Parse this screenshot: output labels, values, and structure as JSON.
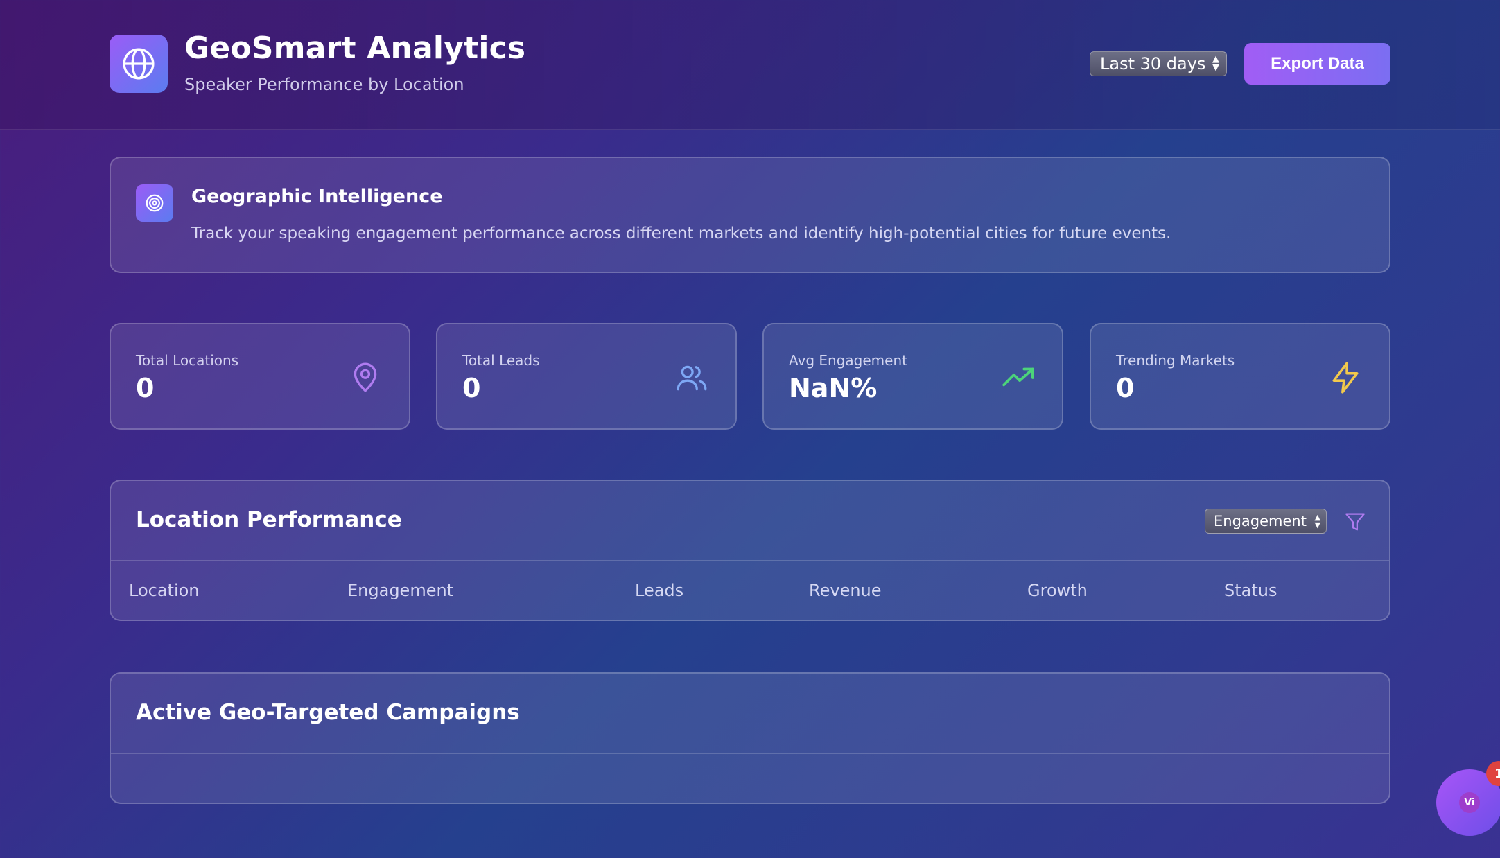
{
  "header": {
    "title": "GeoSmart Analytics",
    "subtitle": "Speaker Performance by Location",
    "logo_icon": "globe-icon",
    "range_select": {
      "value": "Last 30 days"
    },
    "export_label": "Export Data"
  },
  "intel": {
    "icon": "target-icon",
    "title": "Geographic Intelligence",
    "text": "Track your speaking engagement performance across different markets and identify high-potential cities for future events."
  },
  "stats": [
    {
      "label": "Total Locations",
      "value": "0",
      "icon": "map-pin-icon",
      "color": "#b07cf0"
    },
    {
      "label": "Total Leads",
      "value": "0",
      "icon": "users-icon",
      "color": "#7ea8f5"
    },
    {
      "label": "Avg Engagement",
      "value": "NaN%",
      "icon": "trending-up-icon",
      "color": "#4cd47a"
    },
    {
      "label": "Trending Markets",
      "value": "0",
      "icon": "lightning-icon",
      "color": "#f2c94c"
    }
  ],
  "performance": {
    "title": "Location Performance",
    "sort_select": {
      "value": "Engagement"
    },
    "filter_icon": "filter-icon",
    "columns": [
      "Location",
      "Engagement",
      "Leads",
      "Revenue",
      "Growth",
      "Status"
    ]
  },
  "campaigns": {
    "title": "Active Geo-Targeted Campaigns"
  },
  "chat": {
    "initials": "Vi",
    "badge": "1"
  },
  "colors": {
    "accent_purple": "#9b5cf6",
    "accent_blue": "#5b7cf0",
    "badge_red": "#e0433f"
  }
}
